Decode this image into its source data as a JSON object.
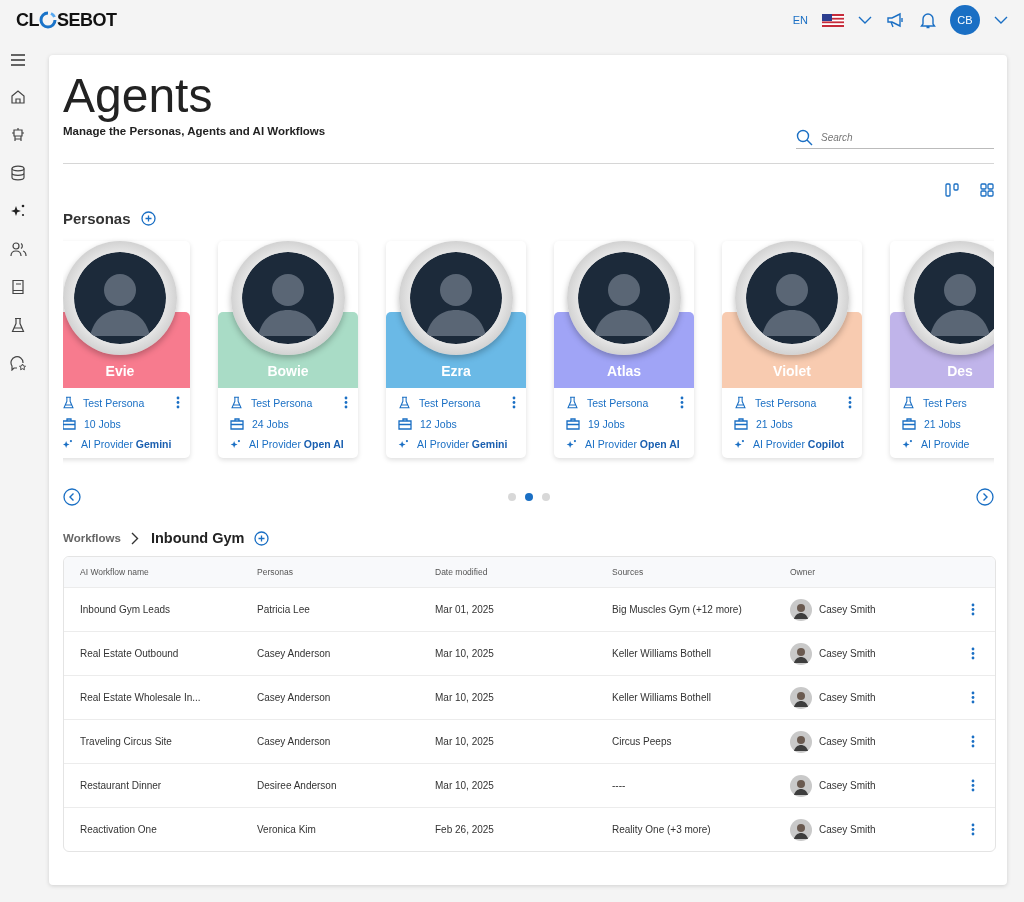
{
  "header": {
    "logo_before": "CL",
    "logo_after": "SEBOT",
    "language": "EN",
    "avatar_initials": "CB"
  },
  "sidebar": {
    "items": [
      {
        "kind": "home"
      },
      {
        "kind": "robot"
      },
      {
        "kind": "database"
      },
      {
        "kind": "sparkle"
      },
      {
        "kind": "users"
      },
      {
        "kind": "book"
      },
      {
        "kind": "flask"
      },
      {
        "kind": "chat"
      }
    ]
  },
  "page": {
    "title": "Agents",
    "subtitle": "Manage the Personas, Agents and AI Workflows",
    "search_placeholder": "Search"
  },
  "personas": {
    "heading": "Personas",
    "items": [
      {
        "name": "Evie",
        "color": "#f77b8e",
        "role": "Test Persona",
        "jobs": "10 Jobs",
        "provider_label": "AI Provider",
        "provider": "Gemini"
      },
      {
        "name": "Bowie",
        "color": "#a9dcc6",
        "role": "Test Persona",
        "jobs": "24 Jobs",
        "provider_label": "AI Provider",
        "provider": "Open AI"
      },
      {
        "name": "Ezra",
        "color": "#6ab9e6",
        "role": "Test Persona",
        "jobs": "12 Jobs",
        "provider_label": "AI Provider",
        "provider": "Gemini"
      },
      {
        "name": "Atlas",
        "color": "#a0a4f6",
        "role": "Test Persona",
        "jobs": "19 Jobs",
        "provider_label": "AI Provider",
        "provider": "Open AI"
      },
      {
        "name": "Violet",
        "color": "#f8cbb0",
        "role": "Test Persona",
        "jobs": "21 Jobs",
        "provider_label": "AI Provider",
        "provider": "Copilot"
      },
      {
        "name": "Des",
        "color": "#c0b4ea",
        "role": "Test Pers",
        "jobs": "21 Jobs",
        "provider_label": "AI Provide"
      }
    ],
    "pages": [
      {
        "selected": false
      },
      {
        "selected": true
      },
      {
        "selected": false
      }
    ]
  },
  "workflows": {
    "crumb": "Workflows",
    "current": "Inbound Gym",
    "columns": [
      "AI Workflow name",
      "Personas",
      "Date modified",
      "Sources",
      "Owner"
    ],
    "rows": [
      {
        "name": "Inbound Gym Leads",
        "persona": "Patricia Lee",
        "date": "Mar 01, 2025",
        "sources": "Big Muscles Gym (+12 more)",
        "owner": "Casey Smith"
      },
      {
        "name": "Real Estate Outbound",
        "persona": "Casey Anderson",
        "date": "Mar 10, 2025",
        "sources": "Keller Williams Bothell",
        "owner": "Casey Smith"
      },
      {
        "name": "Real Estate Wholesale In...",
        "persona": "Casey Anderson",
        "date": "Mar 10, 2025",
        "sources": "Keller Williams Bothell",
        "owner": "Casey Smith"
      },
      {
        "name": "Traveling Circus Site",
        "persona": "Casey Anderson",
        "date": "Mar 10, 2025",
        "sources": "Circus Peeps",
        "owner": "Casey Smith"
      },
      {
        "name": "Restaurant Dinner",
        "persona": "Desiree Anderson",
        "date": "Mar 10, 2025",
        "sources": "----",
        "owner": "Casey Smith"
      },
      {
        "name": "Reactivation One",
        "persona": "Veronica Kim",
        "date": "Feb 26, 2025",
        "sources": "Reality One (+3 more)",
        "owner": "Casey Smith"
      }
    ]
  }
}
